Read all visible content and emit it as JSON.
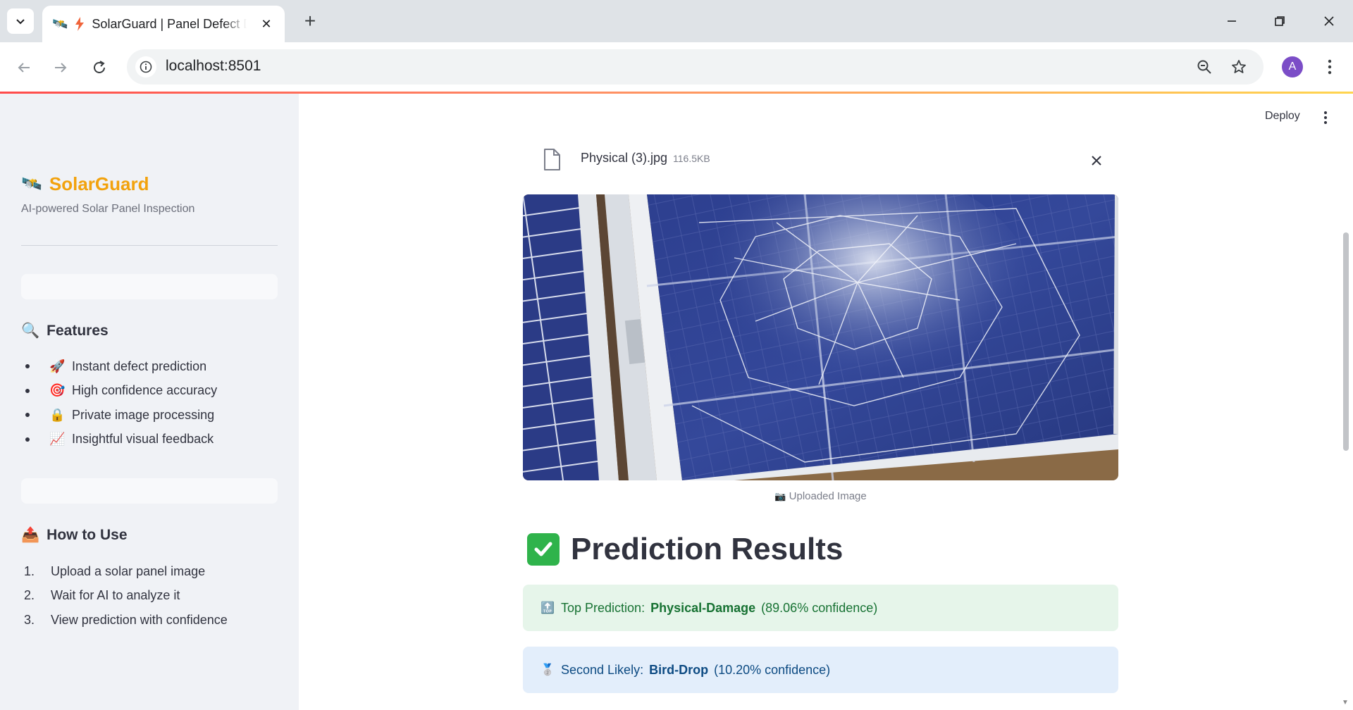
{
  "browser": {
    "tab_title": "SolarGuard | Panel Defect Detection",
    "url": "localhost:8501",
    "profile_initial": "A",
    "new_tab_glyph": "+",
    "tab_close_glyph": "✕"
  },
  "header": {
    "deploy_label": "Deploy"
  },
  "sidebar": {
    "brand_emoji": "🛰️",
    "title": "SolarGuard",
    "subtitle": "AI-powered Solar Panel Inspection",
    "features": {
      "emoji": "🔍",
      "heading": "Features",
      "items": [
        {
          "emoji": "🚀",
          "label": "Instant defect prediction"
        },
        {
          "emoji": "🎯",
          "label": "High confidence accuracy"
        },
        {
          "emoji": "🔒",
          "label": "Private image processing"
        },
        {
          "emoji": "📈",
          "label": "Insightful visual feedback"
        }
      ]
    },
    "how_to": {
      "emoji": "📤",
      "heading": "How to Use",
      "steps": [
        {
          "num": "1.",
          "label": "Upload a solar panel image"
        },
        {
          "num": "2.",
          "label": "Wait for AI to analyze it"
        },
        {
          "num": "3.",
          "label": "View prediction with confidence"
        }
      ]
    }
  },
  "upload": {
    "file_name": "Physical (3).jpg",
    "file_size": "116.5KB",
    "caption_emoji": "📷",
    "caption": "Uploaded Image"
  },
  "results": {
    "heading": "Prediction Results",
    "top": {
      "emoji": "🔝",
      "prefix": "Top Prediction:",
      "label": "Physical-Damage",
      "confidence": "(89.06% confidence)"
    },
    "second": {
      "emoji": "🥈",
      "prefix": "Second Likely:",
      "label": "Bird-Drop",
      "confidence": "(10.20% confidence)"
    }
  },
  "colors": {
    "accent_orange": "#f2a20d",
    "success_bg": "#e6f5ea",
    "success_text": "#177233",
    "info_bg": "#e3eefb",
    "info_text": "#0c4a82"
  }
}
